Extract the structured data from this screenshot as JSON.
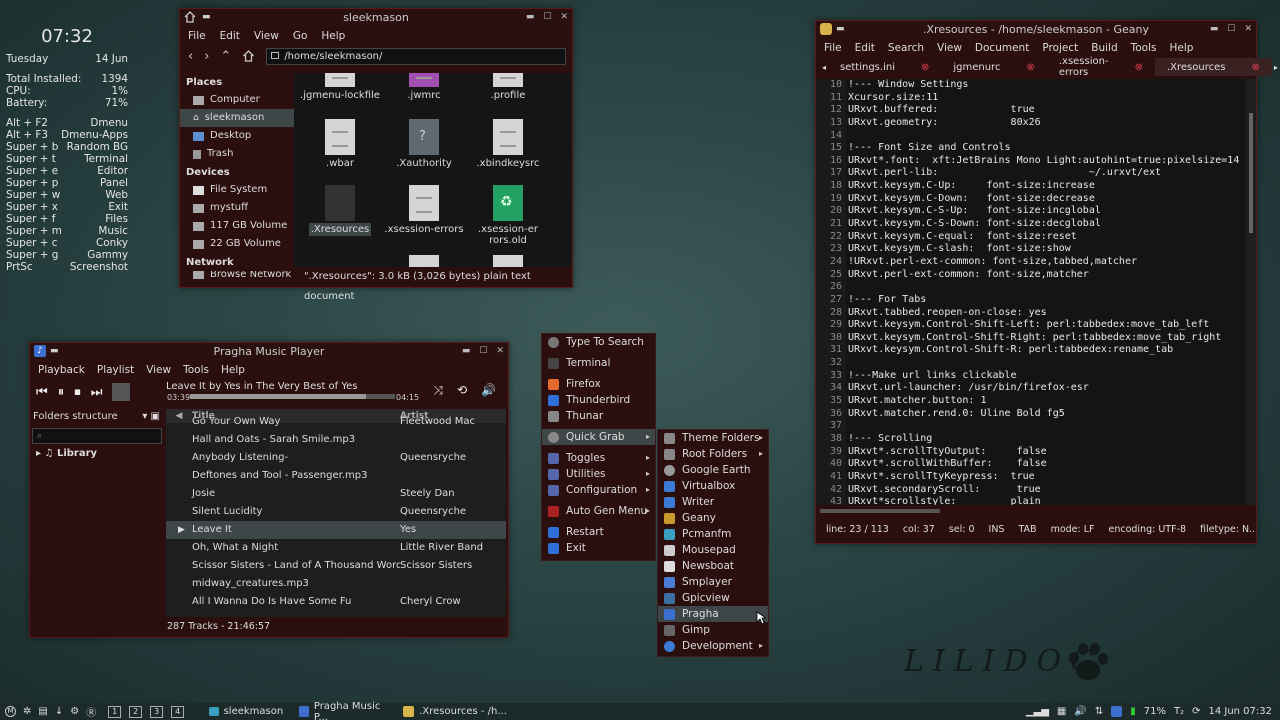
{
  "conky": {
    "time": "07:32",
    "day": "Tuesday",
    "date": "14 Jun",
    "stats": [
      [
        "Total Installed:",
        "1394"
      ],
      [
        "CPU:",
        "1%"
      ],
      [
        "Battery:",
        "71%"
      ]
    ],
    "keys": [
      [
        "Alt + F2",
        "Dmenu"
      ],
      [
        "Alt + F3",
        "Dmenu-Apps"
      ],
      [
        "Super + b",
        "Random BG"
      ],
      [
        "Super + t",
        "Terminal"
      ],
      [
        "Super + e",
        "Editor"
      ],
      [
        "Super + p",
        "Panel"
      ],
      [
        "Super + w",
        "Web"
      ],
      [
        "Super + x",
        "Exit"
      ],
      [
        "Super + f",
        "Files"
      ],
      [
        "Super + m",
        "Music"
      ],
      [
        "Super + c",
        "Conky"
      ],
      [
        "Super + g",
        "Gammy"
      ],
      [
        "PrtSc",
        "Screenshot"
      ]
    ]
  },
  "fm": {
    "title": "sleekmason",
    "menu": [
      "File",
      "Edit",
      "View",
      "Go",
      "Help"
    ],
    "path": "/home/sleekmason/",
    "places_h": "Places",
    "places": [
      "Computer",
      "sleekmason",
      "Desktop",
      "Trash"
    ],
    "devices_h": "Devices",
    "devices": [
      "File System",
      "mystuff",
      "117 GB Volume",
      "22 GB Volume"
    ],
    "network_h": "Network",
    "network": [
      "Browse Network"
    ],
    "files": [
      ".jgmenu-lockfile",
      ".jwmrc",
      ".profile",
      ".wbar",
      ".Xauthority",
      ".xbindkeysrc",
      ".Xresources",
      ".xsession-errors",
      ".xsession-errors.old"
    ],
    "status": "\".Xresources\": 3.0 kB (3,026 bytes) plain text document"
  },
  "player": {
    "title": "Pragha Music Player",
    "menu": [
      "Playback",
      "Playlist",
      "View",
      "Tools",
      "Help"
    ],
    "now": "Leave It by Yes in The Very Best of Yes",
    "elapsed": "03:39",
    "total": "04:15",
    "progress": 0.86,
    "folders": "Folders structure",
    "library": "Library",
    "col_title": "Title",
    "col_artist": "Artist",
    "rows": [
      [
        "Go Your Own Way",
        "Fleetwood Mac"
      ],
      [
        "Hall and Oats - Sarah Smile.mp3",
        ""
      ],
      [
        "Anybody Listening-",
        "Queensryche"
      ],
      [
        "Deftones and Tool - Passenger.mp3",
        ""
      ],
      [
        "Josie",
        "Steely Dan"
      ],
      [
        "Silent Lucidity",
        "Queensryche"
      ],
      [
        "Leave It",
        "Yes"
      ],
      [
        "Oh, What a Night",
        "Little River Band"
      ],
      [
        "Scissor Sisters - Land of A Thousand Word...",
        "Scissor Sisters"
      ],
      [
        "midway_creatures.mp3",
        ""
      ],
      [
        "All I Wanna Do Is Have Some Fu",
        "Cheryl Crow"
      ]
    ],
    "footer": "287 Tracks - 21:46:57"
  },
  "menu1": [
    "Type To Search",
    "Terminal",
    "Firefox",
    "Thunderbird",
    "Thunar",
    "Quick Grab",
    "Toggles",
    "Utilities",
    "Configuration",
    "Auto Gen Menu",
    "Restart",
    "Exit"
  ],
  "menu2": [
    "Theme Folders",
    "Root Folders",
    "Google Earth",
    "Virtualbox",
    "Writer",
    "Geany",
    "Pcmanfm",
    "Mousepad",
    "Newsboat",
    "Smplayer",
    "Gpicview",
    "Pragha",
    "Gimp",
    "Development"
  ],
  "geany": {
    "title": ".Xresources - /home/sleekmason - Geany",
    "menu": [
      "File",
      "Edit",
      "Search",
      "View",
      "Document",
      "Project",
      "Build",
      "Tools",
      "Help"
    ],
    "tabs": [
      "settings.ini",
      "jgmenurc",
      ".xsession-errors",
      ".Xresources"
    ],
    "lines": [
      [
        "10",
        "!--- Window Settings"
      ],
      [
        "11",
        "Xcursor.size:11"
      ],
      [
        "12",
        "URxvt.buffered:            true"
      ],
      [
        "13",
        "URxvt.geometry:            80x26"
      ],
      [
        "14",
        ""
      ],
      [
        "15",
        "!--- Font Size and Controls"
      ],
      [
        "16",
        "URxvt*.font:  xft:JetBrains Mono Light:autohint=true:pixelsize=14"
      ],
      [
        "17",
        "URxvt.perl-lib:                         ~/.urxvt/ext"
      ],
      [
        "18",
        "URxvt.keysym.C-Up:     font-size:increase"
      ],
      [
        "19",
        "URxvt.keysym.C-Down:   font-size:decrease"
      ],
      [
        "20",
        "URxvt.keysym.C-S-Up:   font-size:incglobal"
      ],
      [
        "21",
        "URxvt.keysym.C-S-Down: font-size:decglobal"
      ],
      [
        "22",
        "URxvt.keysym.C-equal:  font-size:reset"
      ],
      [
        "23",
        "URxvt.keysym.C-slash:  font-size:show"
      ],
      [
        "24",
        "!URxvt.perl-ext-common: font-size,tabbed,matcher"
      ],
      [
        "25",
        "URxvt.perl-ext-common: font-size,matcher"
      ],
      [
        "26",
        ""
      ],
      [
        "27",
        "!--- For Tabs"
      ],
      [
        "28",
        "URxvt.tabbed.reopen-on-close: yes"
      ],
      [
        "29",
        "URxvt.keysym.Control-Shift-Left: perl:tabbedex:move_tab_left"
      ],
      [
        "30",
        "URxvt.keysym.Control-Shift-Right: perl:tabbedex:move_tab_right"
      ],
      [
        "31",
        "URxvt.keysym.Control-Shift-R: perl:tabbedex:rename_tab"
      ],
      [
        "32",
        ""
      ],
      [
        "33",
        "!---Make url links clickable"
      ],
      [
        "34",
        "URxvt.url-launcher: /usr/bin/firefox-esr"
      ],
      [
        "35",
        "URxvt.matcher.button: 1"
      ],
      [
        "36",
        "URxvt.matcher.rend.0: Uline Bold fg5"
      ],
      [
        "37",
        ""
      ],
      [
        "38",
        "!--- Scrolling"
      ],
      [
        "39",
        "URxvt*.scrollTtyOutput:     false"
      ],
      [
        "40",
        "URxvt*.scrollWithBuffer:    false"
      ],
      [
        "41",
        "URxvt*.scrollTtyKeypress:  true"
      ],
      [
        "42",
        "URxvt.secondaryScroll:      true"
      ],
      [
        "43",
        "URxvt*scrollstyle:         plain"
      ]
    ],
    "status": [
      "line: 23 / 113",
      "col: 37",
      "sel: 0",
      "INS",
      "TAB",
      "mode: LF",
      "encoding: UTF-8",
      "filetype: N..."
    ]
  },
  "logo": "LILIDOG",
  "taskbar": {
    "workspaces": [
      "1",
      "2",
      "3",
      "4"
    ],
    "tasks": [
      "sleekmason",
      "Pragha Music P...",
      ".Xresources - /h..."
    ],
    "battery": "71%",
    "datetime": "14 Jun 07:32"
  }
}
